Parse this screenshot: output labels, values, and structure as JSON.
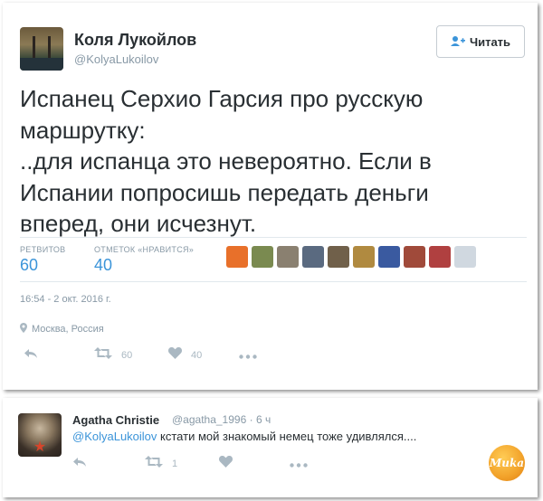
{
  "tweet": {
    "author_name": "Коля Лукойлов",
    "author_handle": "@KolyaLukoilov",
    "follow_label": "Читать",
    "text_lines": [
      "Испанец Серхио Гарсия про русскую",
      "маршрутку:",
      "..для испанца это невероятно. Если в",
      "Испании попросишь передать деньги",
      "вперед, они исчезнут."
    ],
    "retweets_label": "РЕТВИТОВ",
    "retweets_count": "60",
    "likes_label": "ОТМЕТОК «НРАВИТСЯ»",
    "likes_count": "40",
    "timestamp": "16:54 - 2 окт. 2016 г.",
    "location": "Москва, Россия",
    "action_retweet_count": "60",
    "action_like_count": "40",
    "liker_colors": [
      "#e8702a",
      "#7a8a50",
      "#8a8070",
      "#5a6a80",
      "#70604a",
      "#b08a40",
      "#3a5aa0",
      "#a04a3a",
      "#b04040",
      "#d0d8e0"
    ]
  },
  "reply": {
    "author_name": "Agatha Christie",
    "author_handle": "@agatha_1996",
    "age": "· 6 ч",
    "mention": "@KolyaLukoilov",
    "text": " кстати мой знакомый немец тоже удивлялся....",
    "retweet_count": "1"
  },
  "watermark_text": "Muka",
  "colors": {
    "accent": "#3b94d9",
    "muted": "#8899a6",
    "text": "#292f33"
  }
}
